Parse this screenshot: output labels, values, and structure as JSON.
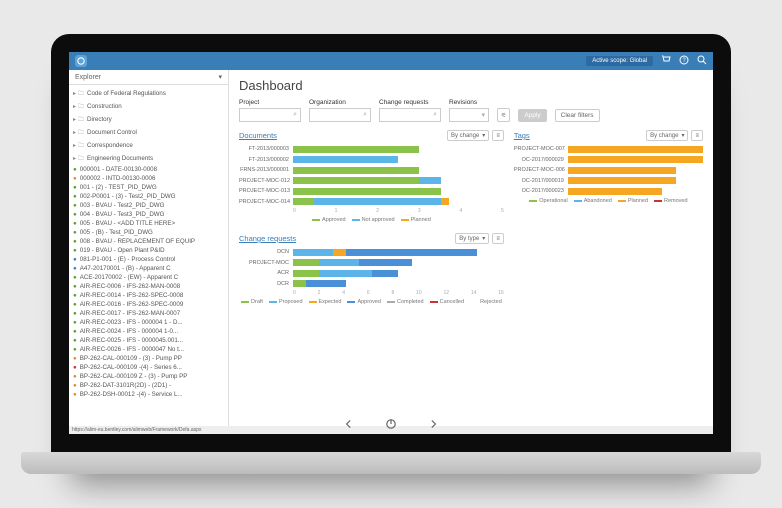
{
  "topbar": {
    "scope": "Active scope: Global"
  },
  "sidebar": {
    "header": "Explorer",
    "nodes": [
      {
        "t": "Code of Federal Regulations",
        "k": "fold",
        "i": 0
      },
      {
        "t": "Construction",
        "k": "fold",
        "i": 0
      },
      {
        "t": "Directory",
        "k": "fold",
        "i": 0
      },
      {
        "t": "Document Control",
        "k": "fold",
        "i": 0
      },
      {
        "t": "Correspondence",
        "k": "fold",
        "i": 1
      },
      {
        "t": "Engineering Documents",
        "k": "fold",
        "i": 1
      },
      {
        "t": "000001 - DATE-00130-0008",
        "k": "g",
        "i": 2
      },
      {
        "t": "000002 - INTD-00130-0006",
        "k": "o",
        "i": 2
      },
      {
        "t": "001 - (2) - TEST_PID_DWG",
        "k": "g",
        "i": 2
      },
      {
        "t": "002-P0001 - (3) - Test2_PID_DWG",
        "k": "g",
        "i": 2
      },
      {
        "t": "003 - BVAU - Test2_PID_DWG",
        "k": "g",
        "i": 2
      },
      {
        "t": "004 - BVAU - Test3_PID_DWG",
        "k": "g",
        "i": 2
      },
      {
        "t": "005 - BVAU - <ADD TITLE HERE>",
        "k": "g",
        "i": 2
      },
      {
        "t": "005 - (B) - Test_PID_DWG",
        "k": "g",
        "i": 2
      },
      {
        "t": "008 - BVAU - REPLACEMENT OF EQUIP",
        "k": "g",
        "i": 2
      },
      {
        "t": "019 - BVAU - Open Plant P&ID",
        "k": "g",
        "i": 2
      },
      {
        "t": "081-P1-001 - (E) - Process Control",
        "k": "doc",
        "i": 2
      },
      {
        "t": "A47-20170001 - (B) - Apparent C",
        "k": "doc",
        "i": 2
      },
      {
        "t": "ACE-20170002 - (EW) - Apparent C",
        "k": "g",
        "i": 2
      },
      {
        "t": "AIR-REC-0006 - IFS-262-MAN-0008",
        "k": "g",
        "i": 2
      },
      {
        "t": "AIR-REC-0014 - IFS-262-SPEC-0008",
        "k": "g",
        "i": 2
      },
      {
        "t": "AIR-REC-0016 - IFS-262-SPEC-0009",
        "k": "g",
        "i": 2
      },
      {
        "t": "AIR-REC-0017 - IFS-262-MAN-0007",
        "k": "g",
        "i": 2
      },
      {
        "t": "AIR-REC-0023 - IFS - 000004 1 - D...",
        "k": "g",
        "i": 2
      },
      {
        "t": "AIR-REC-0024 - IFS - 000004 1-0...",
        "k": "g",
        "i": 2
      },
      {
        "t": "AIR-REC-0025 - IFS - 0000045.001...",
        "k": "g",
        "i": 2
      },
      {
        "t": "AIR-REC-0026 - IFS - 0000047 No t...",
        "k": "g",
        "i": 2
      },
      {
        "t": "BP-262-CAL-000109 - (3) - Pump PP",
        "k": "o",
        "i": 2
      },
      {
        "t": "BP-262-CAL-000109 -(4) - Series 6...",
        "k": "r",
        "i": 2
      },
      {
        "t": "BP-262-CAL-000109 Z - (3) - Pump PP",
        "k": "o",
        "i": 2
      },
      {
        "t": "BP-262-DAT-3101R(2D) - (2D1) -",
        "k": "o",
        "i": 2
      },
      {
        "t": "BP-262-DSH-00012 -(4) - Service L...",
        "k": "o",
        "i": 2
      }
    ]
  },
  "main": {
    "title": "Dashboard",
    "filters": {
      "project": "Project",
      "organization": "Organization",
      "change_requests": "Change requests",
      "revisions": "Revisions",
      "apply": "Apply",
      "clear": "Clear filters"
    },
    "documents": {
      "title": "Documents",
      "selector": "By change",
      "legend": [
        "Approved",
        "Not approved",
        "Planned"
      ]
    },
    "tags": {
      "title": "Tags",
      "selector": "By change",
      "legend": [
        "Operational",
        "Abandoned",
        "Planned",
        "Removed"
      ]
    },
    "changereq": {
      "title": "Change requests",
      "selector": "By type",
      "legend": [
        "Draft",
        "Proposed",
        "Expected",
        "Approved",
        "Completed",
        "Cancelled",
        "Rejected"
      ]
    }
  },
  "chart_data": [
    {
      "type": "bar",
      "title": "Documents",
      "orientation": "horizontal",
      "categories": [
        "FT-2013/000003",
        "FT-2013/000002",
        "FRNS-2013/000001",
        "PROJECT-MOC-012",
        "PROJECT-MOC-013",
        "PROJECT-MOC-014"
      ],
      "series": [
        {
          "name": "Approved",
          "values": [
            3,
            0,
            3,
            3,
            3.5,
            0.5
          ]
        },
        {
          "name": "Not approved",
          "values": [
            0,
            2.5,
            0,
            0.5,
            0,
            3
          ]
        },
        {
          "name": "Planned",
          "values": [
            0,
            0,
            0,
            0,
            0,
            0.2
          ]
        }
      ],
      "xlim": [
        0,
        5
      ],
      "xticks": [
        0,
        1,
        2,
        3,
        4,
        5
      ]
    },
    {
      "type": "bar",
      "title": "Tags",
      "orientation": "horizontal",
      "categories": [
        "PROJECT-MOC-007",
        "OC-2017/000029",
        "PROJECT-MOC-006",
        "OC-2017/000019",
        "OC-2017/000023"
      ],
      "series": [
        {
          "name": "Operational",
          "values": [
            0,
            0,
            0,
            0,
            0
          ]
        },
        {
          "name": "Abandoned",
          "values": [
            0,
            0,
            0,
            0,
            0
          ]
        },
        {
          "name": "Planned",
          "values": [
            5,
            5,
            4,
            4,
            3.5
          ]
        },
        {
          "name": "Removed",
          "values": [
            0,
            0,
            0,
            0,
            0
          ]
        }
      ],
      "xlim": [
        0,
        5
      ]
    },
    {
      "type": "bar",
      "title": "Change requests",
      "orientation": "horizontal",
      "categories": [
        "DCN",
        "PROJECT-MOC",
        "ACR",
        "DCR"
      ],
      "series": [
        {
          "name": "Draft",
          "values": [
            0,
            2,
            2,
            1
          ]
        },
        {
          "name": "Proposed",
          "values": [
            3,
            3,
            4,
            0
          ]
        },
        {
          "name": "Expected",
          "values": [
            1,
            0,
            0,
            0
          ]
        },
        {
          "name": "Approved",
          "values": [
            10,
            4,
            2,
            3
          ]
        },
        {
          "name": "Completed",
          "values": [
            0,
            0,
            0,
            0
          ]
        },
        {
          "name": "Cancelled",
          "values": [
            0,
            0,
            0,
            0
          ]
        },
        {
          "name": "Rejected",
          "values": [
            0,
            0,
            0,
            0
          ]
        }
      ],
      "xlim": [
        0,
        16
      ],
      "xticks": [
        0,
        2,
        4,
        6,
        8,
        10,
        12,
        14,
        16
      ]
    }
  ],
  "statusbar": "https://alim-eu.bentley.com/alimweb/Framework/Defa.aspx"
}
